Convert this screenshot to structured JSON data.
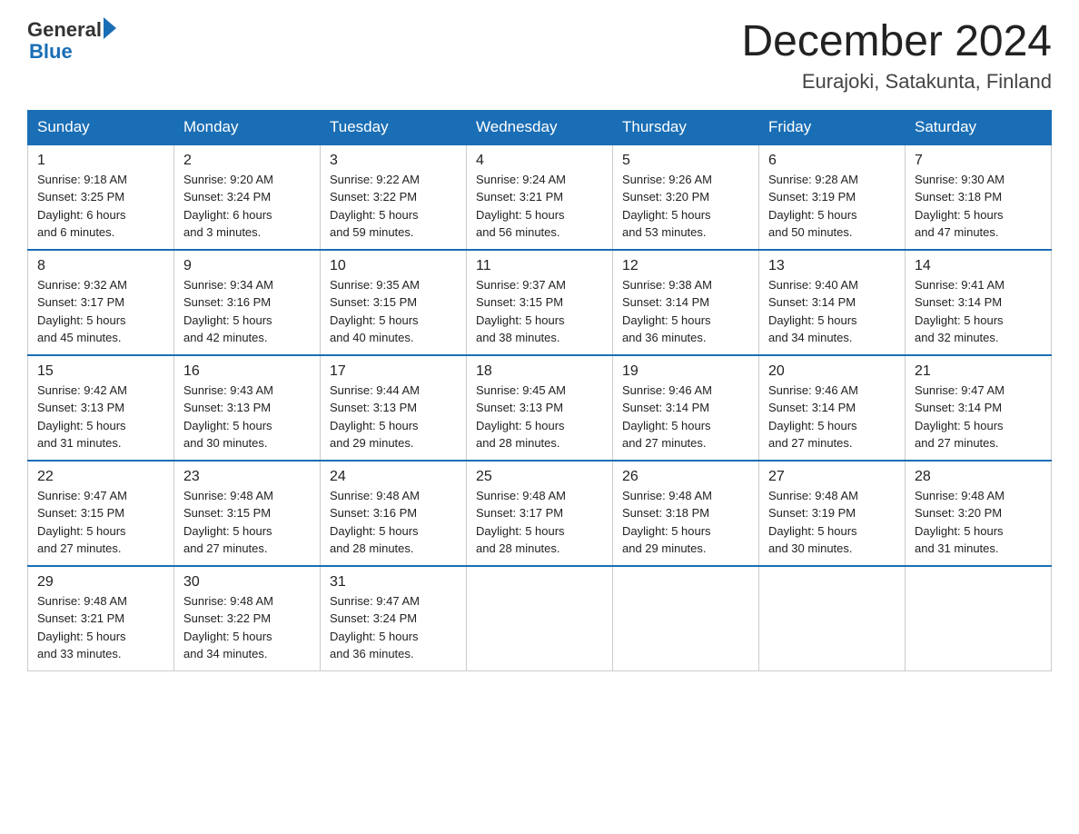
{
  "header": {
    "logo_general": "General",
    "logo_blue": "Blue",
    "month_title": "December 2024",
    "location": "Eurajoki, Satakunta, Finland"
  },
  "days_of_week": [
    "Sunday",
    "Monday",
    "Tuesday",
    "Wednesday",
    "Thursday",
    "Friday",
    "Saturday"
  ],
  "weeks": [
    [
      {
        "day": "1",
        "sunrise": "9:18 AM",
        "sunset": "3:25 PM",
        "daylight": "6 hours and 6 minutes."
      },
      {
        "day": "2",
        "sunrise": "9:20 AM",
        "sunset": "3:24 PM",
        "daylight": "6 hours and 3 minutes."
      },
      {
        "day": "3",
        "sunrise": "9:22 AM",
        "sunset": "3:22 PM",
        "daylight": "5 hours and 59 minutes."
      },
      {
        "day": "4",
        "sunrise": "9:24 AM",
        "sunset": "3:21 PM",
        "daylight": "5 hours and 56 minutes."
      },
      {
        "day": "5",
        "sunrise": "9:26 AM",
        "sunset": "3:20 PM",
        "daylight": "5 hours and 53 minutes."
      },
      {
        "day": "6",
        "sunrise": "9:28 AM",
        "sunset": "3:19 PM",
        "daylight": "5 hours and 50 minutes."
      },
      {
        "day": "7",
        "sunrise": "9:30 AM",
        "sunset": "3:18 PM",
        "daylight": "5 hours and 47 minutes."
      }
    ],
    [
      {
        "day": "8",
        "sunrise": "9:32 AM",
        "sunset": "3:17 PM",
        "daylight": "5 hours and 45 minutes."
      },
      {
        "day": "9",
        "sunrise": "9:34 AM",
        "sunset": "3:16 PM",
        "daylight": "5 hours and 42 minutes."
      },
      {
        "day": "10",
        "sunrise": "9:35 AM",
        "sunset": "3:15 PM",
        "daylight": "5 hours and 40 minutes."
      },
      {
        "day": "11",
        "sunrise": "9:37 AM",
        "sunset": "3:15 PM",
        "daylight": "5 hours and 38 minutes."
      },
      {
        "day": "12",
        "sunrise": "9:38 AM",
        "sunset": "3:14 PM",
        "daylight": "5 hours and 36 minutes."
      },
      {
        "day": "13",
        "sunrise": "9:40 AM",
        "sunset": "3:14 PM",
        "daylight": "5 hours and 34 minutes."
      },
      {
        "day": "14",
        "sunrise": "9:41 AM",
        "sunset": "3:14 PM",
        "daylight": "5 hours and 32 minutes."
      }
    ],
    [
      {
        "day": "15",
        "sunrise": "9:42 AM",
        "sunset": "3:13 PM",
        "daylight": "5 hours and 31 minutes."
      },
      {
        "day": "16",
        "sunrise": "9:43 AM",
        "sunset": "3:13 PM",
        "daylight": "5 hours and 30 minutes."
      },
      {
        "day": "17",
        "sunrise": "9:44 AM",
        "sunset": "3:13 PM",
        "daylight": "5 hours and 29 minutes."
      },
      {
        "day": "18",
        "sunrise": "9:45 AM",
        "sunset": "3:13 PM",
        "daylight": "5 hours and 28 minutes."
      },
      {
        "day": "19",
        "sunrise": "9:46 AM",
        "sunset": "3:14 PM",
        "daylight": "5 hours and 27 minutes."
      },
      {
        "day": "20",
        "sunrise": "9:46 AM",
        "sunset": "3:14 PM",
        "daylight": "5 hours and 27 minutes."
      },
      {
        "day": "21",
        "sunrise": "9:47 AM",
        "sunset": "3:14 PM",
        "daylight": "5 hours and 27 minutes."
      }
    ],
    [
      {
        "day": "22",
        "sunrise": "9:47 AM",
        "sunset": "3:15 PM",
        "daylight": "5 hours and 27 minutes."
      },
      {
        "day": "23",
        "sunrise": "9:48 AM",
        "sunset": "3:15 PM",
        "daylight": "5 hours and 27 minutes."
      },
      {
        "day": "24",
        "sunrise": "9:48 AM",
        "sunset": "3:16 PM",
        "daylight": "5 hours and 28 minutes."
      },
      {
        "day": "25",
        "sunrise": "9:48 AM",
        "sunset": "3:17 PM",
        "daylight": "5 hours and 28 minutes."
      },
      {
        "day": "26",
        "sunrise": "9:48 AM",
        "sunset": "3:18 PM",
        "daylight": "5 hours and 29 minutes."
      },
      {
        "day": "27",
        "sunrise": "9:48 AM",
        "sunset": "3:19 PM",
        "daylight": "5 hours and 30 minutes."
      },
      {
        "day": "28",
        "sunrise": "9:48 AM",
        "sunset": "3:20 PM",
        "daylight": "5 hours and 31 minutes."
      }
    ],
    [
      {
        "day": "29",
        "sunrise": "9:48 AM",
        "sunset": "3:21 PM",
        "daylight": "5 hours and 33 minutes."
      },
      {
        "day": "30",
        "sunrise": "9:48 AM",
        "sunset": "3:22 PM",
        "daylight": "5 hours and 34 minutes."
      },
      {
        "day": "31",
        "sunrise": "9:47 AM",
        "sunset": "3:24 PM",
        "daylight": "5 hours and 36 minutes."
      },
      null,
      null,
      null,
      null
    ]
  ],
  "labels": {
    "sunrise": "Sunrise:",
    "sunset": "Sunset:",
    "daylight": "Daylight:"
  }
}
